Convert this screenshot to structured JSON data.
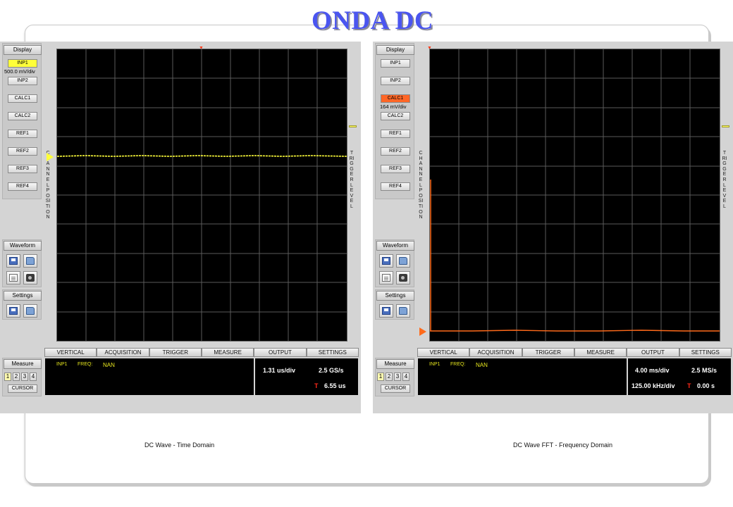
{
  "title": "ONDA DC",
  "left": {
    "caption": "DC Wave - Time Domain",
    "display_label": "Display",
    "sources": [
      "INP1",
      "INP2",
      "CALC1",
      "CALC2",
      "REF1",
      "REF2",
      "REF3",
      "REF4"
    ],
    "active_scale": "500.0 mV/div",
    "waveform_label": "Waveform",
    "settings_label": "Settings",
    "measure_label": "Measure",
    "measure_slots": [
      "1",
      "2",
      "3",
      "4"
    ],
    "cursor_label": "CURSOR",
    "channel_label": "CHANNEL POSITION",
    "trigger_label": "TRIGGER LEVEL",
    "tabs": [
      "VERTICAL",
      "ACQUISITION",
      "TRIGGER",
      "MEASURE",
      "OUTPUT",
      "SETTINGS"
    ],
    "meas_source": "INP1",
    "meas_name": "FREQ:",
    "meas_value": "NAN",
    "timebase": "1.31 us/div",
    "sample_rate": "2.5 GS/s",
    "trigger_marker": "T",
    "trigger_time": "6.55 us",
    "trace_color": "#ffff3a"
  },
  "right": {
    "caption": "DC Wave FFT - Frequency Domain",
    "display_label": "Display",
    "sources": [
      "INP1",
      "INP2",
      "CALC1",
      "CALC2",
      "REF1",
      "REF2",
      "REF3",
      "REF4"
    ],
    "active_scale": "164 mV/div",
    "waveform_label": "Waveform",
    "settings_label": "Settings",
    "measure_label": "Measure",
    "measure_slots": [
      "1",
      "2",
      "3",
      "4"
    ],
    "cursor_label": "CURSOR",
    "channel_label": "CHANNEL POSITION",
    "trigger_label": "TRIGGER LEVEL",
    "tabs": [
      "VERTICAL",
      "ACQUISITION",
      "TRIGGER",
      "MEASURE",
      "OUTPUT",
      "SETTINGS"
    ],
    "meas_source": "INP1",
    "meas_name": "FREQ:",
    "meas_value": "NAN",
    "timebase": "4.00 ms/div",
    "freq_scale": "125.00 kHz/div",
    "sample_rate": "2.5 MS/s",
    "trigger_marker": "T",
    "trigger_time": "0.00 s",
    "trace_color": "#ff6a1a"
  }
}
